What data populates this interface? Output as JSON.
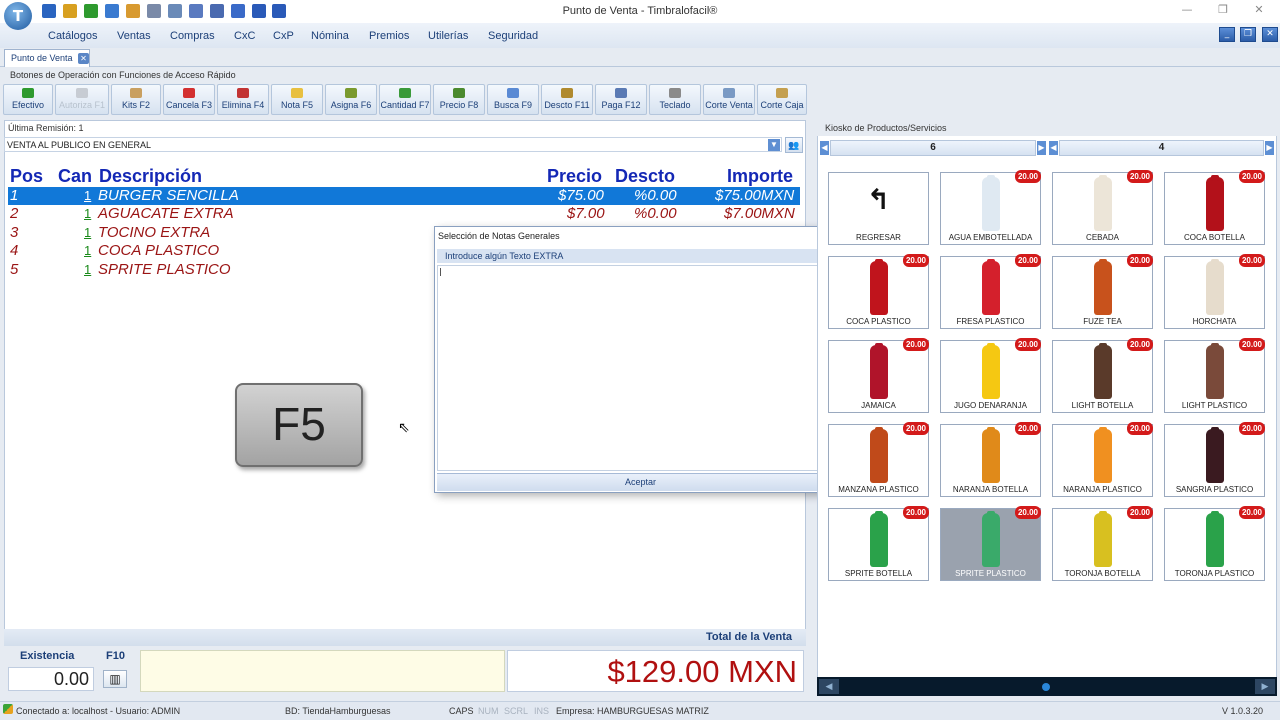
{
  "window": {
    "title": "Punto de Venta - Timbralofacil®"
  },
  "quick_icons": [
    "nav-icon",
    "key-icon",
    "money-icon",
    "calculator-icon",
    "cart-icon",
    "document-icon",
    "chart-icon",
    "eye-icon",
    "signal-icon",
    "windows-icon",
    "layout-icon",
    "columns-icon"
  ],
  "window_controls": {
    "minimize": "—",
    "restore": "❐",
    "close": "✕"
  },
  "menu": [
    "Catálogos",
    "Ventas",
    "Compras",
    "CxC",
    "CxP",
    "Nómina",
    "Premios",
    "Utilerías",
    "Seguridad"
  ],
  "mdi_controls": {
    "minimize": "_",
    "restore": "❐",
    "close": "✕"
  },
  "tab": {
    "label": "Punto de Venta",
    "close": "✕"
  },
  "toolbar": {
    "title": "Botones de Operación con Funciones de Acceso Rápido",
    "buttons": [
      {
        "label": "Efectivo",
        "color": "#2e9a2e"
      },
      {
        "label": "Autoriza F1",
        "color": "#c7ccd3"
      },
      {
        "label": "Kits F2",
        "color": "#c9a060"
      },
      {
        "label": "Cancela F3",
        "color": "#d33030"
      },
      {
        "label": "Elimina F4",
        "color": "#c23434"
      },
      {
        "label": "Nota F5",
        "color": "#e8c040"
      },
      {
        "label": "Asigna F6",
        "color": "#7a9a2e"
      },
      {
        "label": "Cantidad F7",
        "color": "#3a9a3a"
      },
      {
        "label": "Precio F8",
        "color": "#4b8a2e"
      },
      {
        "label": "Busca F9",
        "color": "#5a8ad4"
      },
      {
        "label": "Descto F11",
        "color": "#b08a2e"
      },
      {
        "label": "Paga F12",
        "color": "#5a7ab4"
      },
      {
        "label": "Teclado",
        "color": "#8a8a8a"
      },
      {
        "label": "Corte Venta",
        "color": "#7a9ac4"
      },
      {
        "label": "Corte Caja",
        "color": "#c4a050"
      }
    ]
  },
  "sale": {
    "remision": "Última Remisión: 1",
    "client": "VENTA AL PUBLICO EN GENERAL",
    "client_arrow": "▼",
    "client_button": "👥",
    "headers": {
      "pos": "Pos",
      "can": "Can",
      "desc": "Descripción",
      "precio": "Precio",
      "descto": "Descto",
      "importe": "Importe"
    },
    "rows": [
      {
        "pos": "1",
        "qty": "1",
        "desc": "BURGER SENCILLA",
        "precio": "$75.00",
        "descto": "%0.00",
        "importe": "$75.00MXN"
      },
      {
        "pos": "2",
        "qty": "1",
        "desc": "AGUACATE EXTRA",
        "precio": "$7.00",
        "descto": "%0.00",
        "importe": "$7.00MXN"
      },
      {
        "pos": "3",
        "qty": "1",
        "desc": "TOCINO EXTRA",
        "precio": "",
        "descto": "",
        "importe": ""
      },
      {
        "pos": "4",
        "qty": "1",
        "desc": "COCA PLASTICO",
        "precio": "",
        "descto": "",
        "importe": ""
      },
      {
        "pos": "5",
        "qty": "1",
        "desc": "SPRITE PLASTICO",
        "precio": "",
        "descto": "",
        "importe": ""
      }
    ],
    "total_label": "Total de la Venta",
    "existencia_label": "Existencia",
    "existencia_value": "0.00",
    "f10_label": "F10",
    "barcode_icon": "▥",
    "total": "$129.00 MXN"
  },
  "overlay": {
    "key": "F5",
    "cursor": "⇖"
  },
  "dialog": {
    "title": "Selección de Notas Generales",
    "close": "✕",
    "group_label": "Introduce algún Texto EXTRA",
    "text_value": "",
    "accept": "Aceptar"
  },
  "kiosk": {
    "title": "Kiosko de Productos/Servicios",
    "page_left": "6",
    "page_right": "4",
    "arrow_left": "◀",
    "arrow_right": "▶",
    "products": [
      {
        "name": "REGRESAR",
        "price": "",
        "color": "",
        "icon": "back-arrow-icon"
      },
      {
        "name": "AGUA EMBOTELLADA",
        "price": "20.00",
        "color": "#dfe9f2"
      },
      {
        "name": "CEBADA",
        "price": "20.00",
        "color": "#ece5d8"
      },
      {
        "name": "COCA BOTELLA",
        "price": "20.00",
        "color": "#b3111a"
      },
      {
        "name": "COCA PLASTICO",
        "price": "20.00",
        "color": "#c0141c"
      },
      {
        "name": "FRESA PLASTICO",
        "price": "20.00",
        "color": "#d4202c"
      },
      {
        "name": "FUZE TEA",
        "price": "20.00",
        "color": "#c8521c"
      },
      {
        "name": "HORCHATA",
        "price": "20.00",
        "color": "#e6dccc"
      },
      {
        "name": "JAMAICA",
        "price": "20.00",
        "color": "#b0142a"
      },
      {
        "name": "JUGO DENARANJA",
        "price": "20.00",
        "color": "#f5c812"
      },
      {
        "name": "LIGHT BOTELLA",
        "price": "20.00",
        "color": "#5a3a2a"
      },
      {
        "name": "LIGHT PLASTICO",
        "price": "20.00",
        "color": "#7a4a3a"
      },
      {
        "name": "MANZANA PLASTICO",
        "price": "20.00",
        "color": "#c04a1a"
      },
      {
        "name": "NARANJA BOTELLA",
        "price": "20.00",
        "color": "#e08a1a"
      },
      {
        "name": "NARANJA PLASTICO",
        "price": "20.00",
        "color": "#f09020"
      },
      {
        "name": "SANGRIA PLASTICO",
        "price": "20.00",
        "color": "#3a1a20"
      },
      {
        "name": "SPRITE BOTELLA",
        "price": "20.00",
        "color": "#2aa24a"
      },
      {
        "name": "SPRITE PLASTICO",
        "price": "20.00",
        "color": "#3aaa6a"
      },
      {
        "name": "TORONJA BOTELLA",
        "price": "20.00",
        "color": "#d8c020"
      },
      {
        "name": "TORONJA PLASTICO",
        "price": "20.00",
        "color": "#2aa24a"
      }
    ]
  },
  "status": {
    "connection": "Conectado a: localhost - Usuario: ADMIN",
    "db": "BD: TiendaHamburguesas",
    "caps": "CAPS",
    "num": "NUM",
    "scrl": "SCRL",
    "ins": "INS",
    "company": "Empresa: HAMBURGUESAS MATRIZ",
    "version": "V 1.0.3.20"
  },
  "colors": {
    "accent": "#1428b5",
    "selected_row": "#1178d8",
    "price_badge": "#d31a1a",
    "total_text": "#b01010"
  }
}
